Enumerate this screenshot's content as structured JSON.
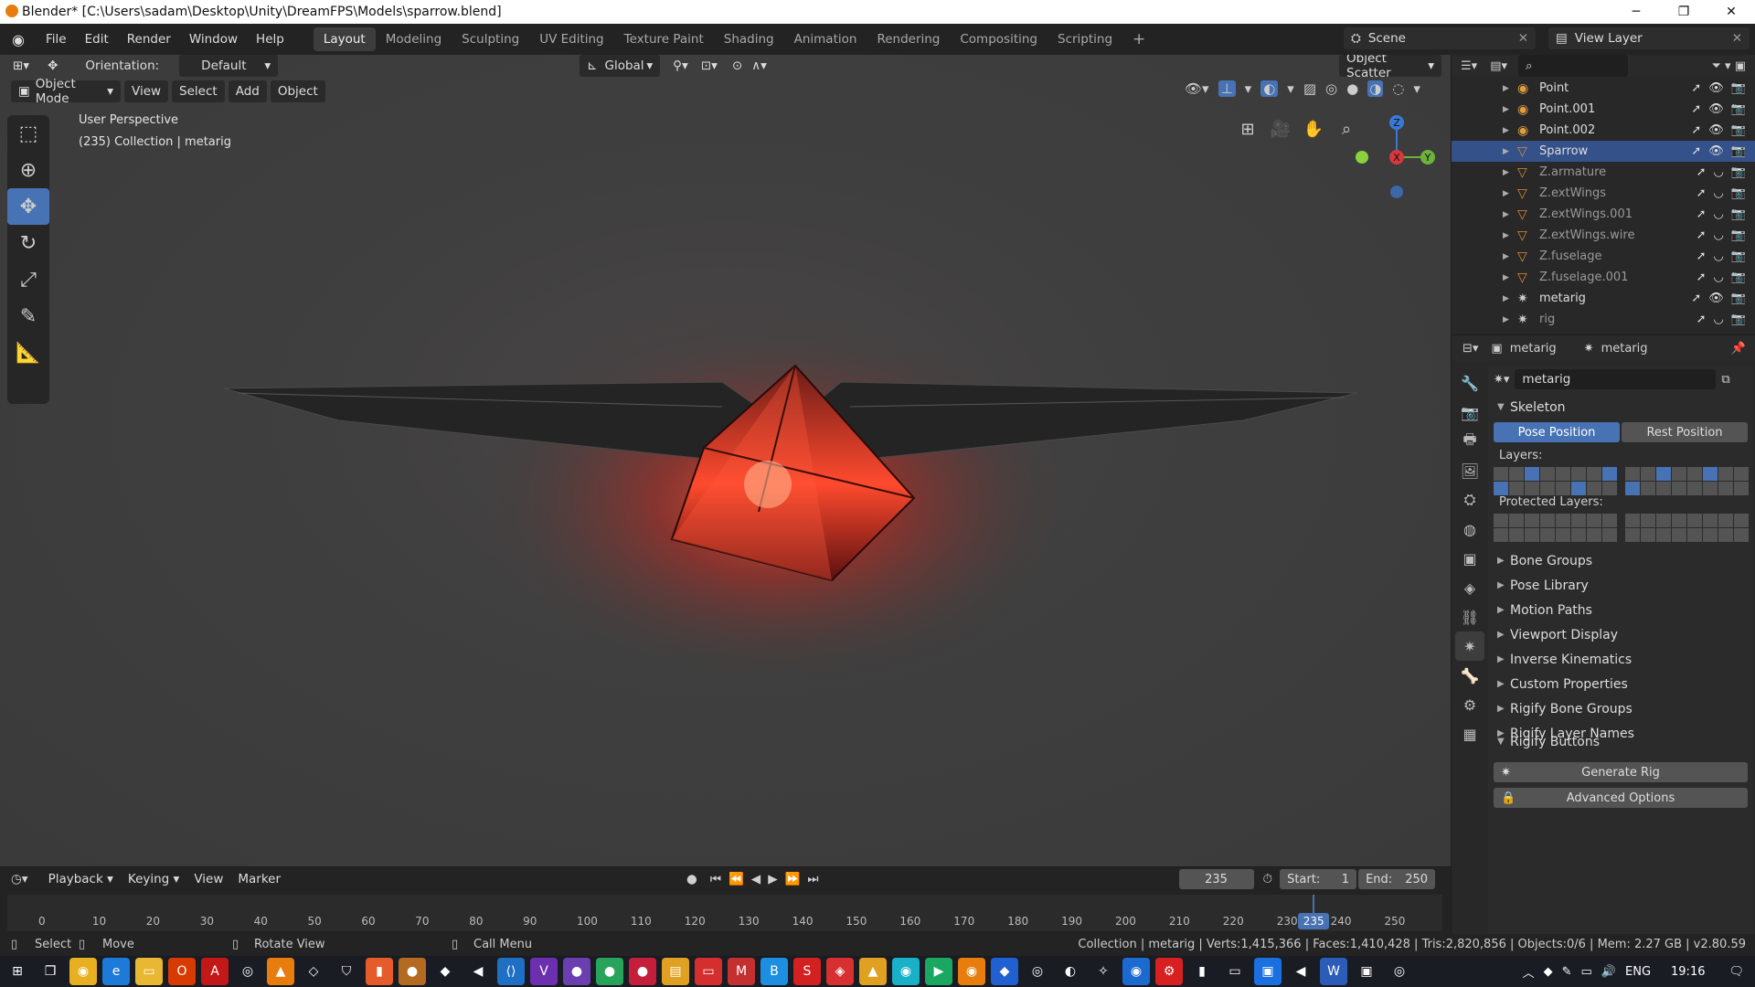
{
  "window": {
    "title": "Blender* [C:\\Users\\sadam\\Desktop\\Unity\\DreamFPS\\Models\\sparrow.blend]",
    "controls": [
      "─",
      "❐",
      "✕"
    ]
  },
  "menus": [
    "File",
    "Edit",
    "Render",
    "Window",
    "Help"
  ],
  "workspaces": [
    "Layout",
    "Modeling",
    "Sculpting",
    "UV Editing",
    "Texture Paint",
    "Shading",
    "Animation",
    "Rendering",
    "Compositing",
    "Scripting"
  ],
  "scene": {
    "name": "Scene",
    "view_layer": "View Layer"
  },
  "tool_header": {
    "orientation_label": "Orientation:",
    "orientation_value": "Default",
    "transform": "Global",
    "scatter": "Object Scatter"
  },
  "viewport_header": {
    "mode": "Object Mode",
    "menus": [
      "View",
      "Select",
      "Add",
      "Object"
    ]
  },
  "viewport": {
    "perspective": "User Perspective",
    "info": "(235) Collection | metarig"
  },
  "gizmo": {
    "x": "X",
    "y": "Y",
    "z": "Z"
  },
  "outliner": [
    {
      "name": "Point",
      "type": "light",
      "selected": false,
      "dim": false
    },
    {
      "name": "Point.001",
      "type": "light",
      "selected": false,
      "dim": false
    },
    {
      "name": "Point.002",
      "type": "light",
      "selected": false,
      "dim": false
    },
    {
      "name": "Sparrow",
      "type": "mesh",
      "selected": true,
      "dim": false
    },
    {
      "name": "Z.armature",
      "type": "mesh",
      "selected": false,
      "dim": true
    },
    {
      "name": "Z.extWings",
      "type": "mesh",
      "selected": false,
      "dim": true
    },
    {
      "name": "Z.extWings.001",
      "type": "mesh",
      "selected": false,
      "dim": true
    },
    {
      "name": "Z.extWings.wire",
      "type": "mesh",
      "selected": false,
      "dim": true
    },
    {
      "name": "Z.fuselage",
      "type": "mesh",
      "selected": false,
      "dim": true
    },
    {
      "name": "Z.fuselage.001",
      "type": "mesh",
      "selected": false,
      "dim": true
    },
    {
      "name": "metarig",
      "type": "armature",
      "selected": false,
      "dim": false
    },
    {
      "name": "rig",
      "type": "armature",
      "selected": false,
      "dim": true
    }
  ],
  "properties": {
    "breadcrumb_object": "metarig",
    "breadcrumb_data": "metarig",
    "data_name": "metarig",
    "skeleton_title": "Skeleton",
    "pose_position": "Pose Position",
    "rest_position": "Rest Position",
    "layers_label": "Layers:",
    "protected_label": "Protected Layers:",
    "panels": [
      "Bone Groups",
      "Pose Library",
      "Motion Paths",
      "Viewport Display",
      "Inverse Kinematics",
      "Custom Properties",
      "Rigify Bone Groups",
      "Rigify Layer Names"
    ],
    "rigify_buttons_title": "Rigify Buttons",
    "generate_rig": "Generate Rig",
    "advanced_options": "Advanced Options"
  },
  "timeline": {
    "menus": [
      "Playback",
      "Keying",
      "View",
      "Marker"
    ],
    "current_frame": "235",
    "start_label": "Start:",
    "start": "1",
    "end_label": "End:",
    "end": "250",
    "ticks": [
      "0",
      "10",
      "20",
      "30",
      "40",
      "50",
      "60",
      "70",
      "80",
      "90",
      "100",
      "110",
      "120",
      "130",
      "140",
      "150",
      "160",
      "170",
      "180",
      "190",
      "200",
      "210",
      "220",
      "230",
      "240",
      "250"
    ]
  },
  "statusbar": {
    "select": "Select",
    "move": "Move",
    "rotate": "Rotate View",
    "call_menu": "Call Menu",
    "stats": "Collection | metarig | Verts:1,415,366 | Faces:1,410,428 | Tris:2,820,856 | Objects:0/6 | Mem: 2.27 GB | v2.80.59"
  },
  "taskbar": {
    "language": "ENG",
    "time": "19:16"
  },
  "colors": {
    "accent": "#4772b3",
    "selection": "#34518a",
    "glow": "#ff3a2a"
  }
}
